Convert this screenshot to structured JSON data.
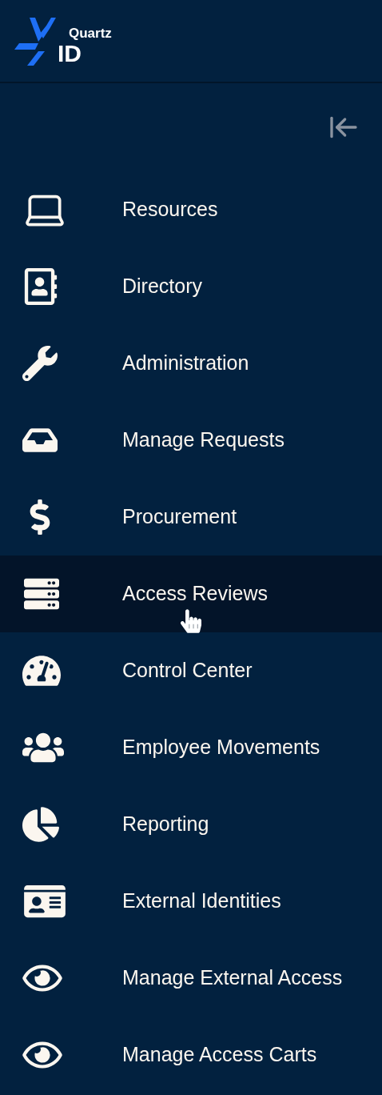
{
  "logo": {
    "top": "Quartz",
    "bottom": "ID"
  },
  "nav": [
    {
      "label": "Resources",
      "hovered": false
    },
    {
      "label": "Directory",
      "hovered": false
    },
    {
      "label": "Administration",
      "hovered": false
    },
    {
      "label": "Manage Requests",
      "hovered": false
    },
    {
      "label": "Procurement",
      "hovered": false
    },
    {
      "label": "Access Reviews",
      "hovered": true
    },
    {
      "label": "Control Center",
      "hovered": false
    },
    {
      "label": "Employee Movements",
      "hovered": false
    },
    {
      "label": "Reporting",
      "hovered": false
    },
    {
      "label": "External Identities",
      "hovered": false
    },
    {
      "label": "Manage External Access",
      "hovered": false
    },
    {
      "label": "Manage Access Carts",
      "hovered": false
    }
  ]
}
